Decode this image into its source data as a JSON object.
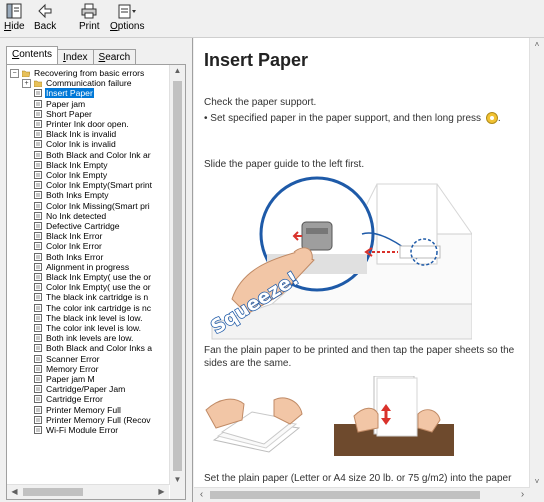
{
  "toolbar": {
    "hide": {
      "pre": "",
      "u": "H",
      "post": "ide"
    },
    "back": {
      "pre": "",
      "u": "",
      "post": "Back"
    },
    "print": {
      "pre": "",
      "u": "",
      "post": "Print"
    },
    "options": {
      "pre": "",
      "u": "O",
      "post": "ptions"
    }
  },
  "nav": {
    "tabs": [
      {
        "pre": "",
        "u": "C",
        "post": "ontents"
      },
      {
        "pre": "",
        "u": "I",
        "post": "ndex"
      },
      {
        "pre": "",
        "u": "S",
        "post": "earch"
      }
    ]
  },
  "tree": {
    "root": "Recovering from basic errors",
    "folder": "Communication failure",
    "items": [
      "Insert Paper",
      "Paper jam",
      "Short Paper",
      "Printer Ink door open.",
      "Black Ink is invalid",
      "Color Ink is invalid",
      "Both Black and Color Ink ar",
      "Black Ink Empty",
      "Color Ink Empty",
      "Color Ink Empty(Smart print",
      "Both Inks Empty",
      "Color Ink Missing(Smart pri",
      "No Ink detected",
      "Defective Cartridge",
      "Black Ink Error",
      "Color Ink Error",
      "Both Inks Error",
      "Alignment in progress",
      "Black Ink Empty( use the or",
      "Color Ink Empty( use the or",
      "The black ink cartridge is n",
      "The color ink cartridge is nc",
      "The black ink level is low.",
      "The color ink level is low.",
      "Both ink levels are low.",
      "Both Black and Color Inks a",
      "Scanner Error",
      "Memory Error",
      "Paper jam M",
      "Cartridge/Paper Jam",
      "Cartridge Error",
      "Printer Memory Full",
      "Printer Memory Full (Recov",
      "Wi-Fi Module Error"
    ]
  },
  "content": {
    "title": "Insert Paper",
    "p1": "Check the paper support.",
    "p2": "• Set specified paper in the paper support, and then long press",
    "p2_end": ".",
    "p3": "Slide the paper guide to the left first.",
    "squeeze": "Squeeze!",
    "p4": "Fan the plain paper to be printed and then tap the paper sheets so the sides are the same.",
    "p5": "Set the plain paper (Letter or A4 size 20 lb. or 75 g/m2) into the paper"
  },
  "colors": {
    "selection": "#0078d7",
    "folder": "#e8c15a",
    "accent_blue": "#1e5aa8",
    "paper_guide_red": "#d9322b",
    "start_button_yellow": "#f1c232"
  }
}
